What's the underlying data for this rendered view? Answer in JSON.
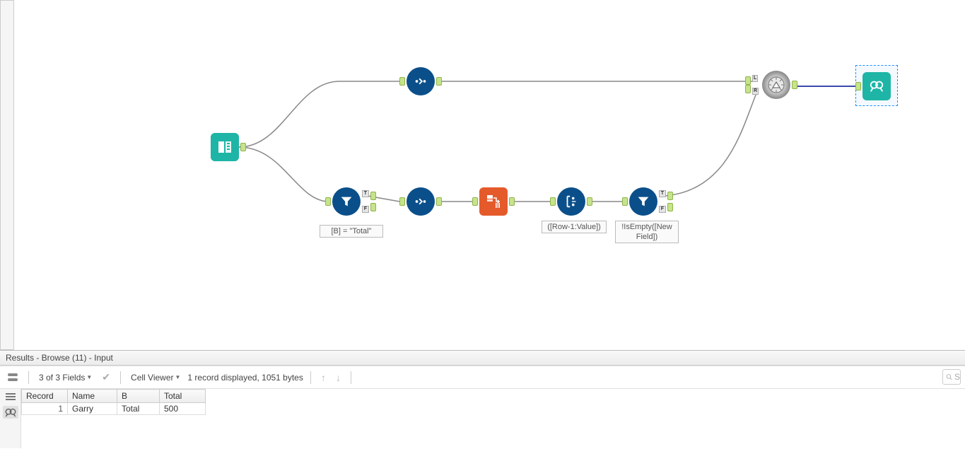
{
  "canvas": {
    "annotations": {
      "filter1": "[B] = \"Total\"",
      "formula1": "([Row-1:Value])",
      "filter2": "!IsEmpty([New Field])"
    }
  },
  "results": {
    "title": "Results - Browse (11) - Input",
    "toolbar": {
      "fields_summary": "3 of 3 Fields",
      "cell_viewer_label": "Cell Viewer",
      "record_summary": "1 record displayed, 1051 bytes",
      "search_placeholder": "S"
    },
    "grid": {
      "columns": [
        "Record",
        "Name",
        "B",
        "Total"
      ],
      "rows": [
        {
          "record": "1",
          "Name": "Garry",
          "B": "Total",
          "Total": "500"
        }
      ]
    }
  }
}
